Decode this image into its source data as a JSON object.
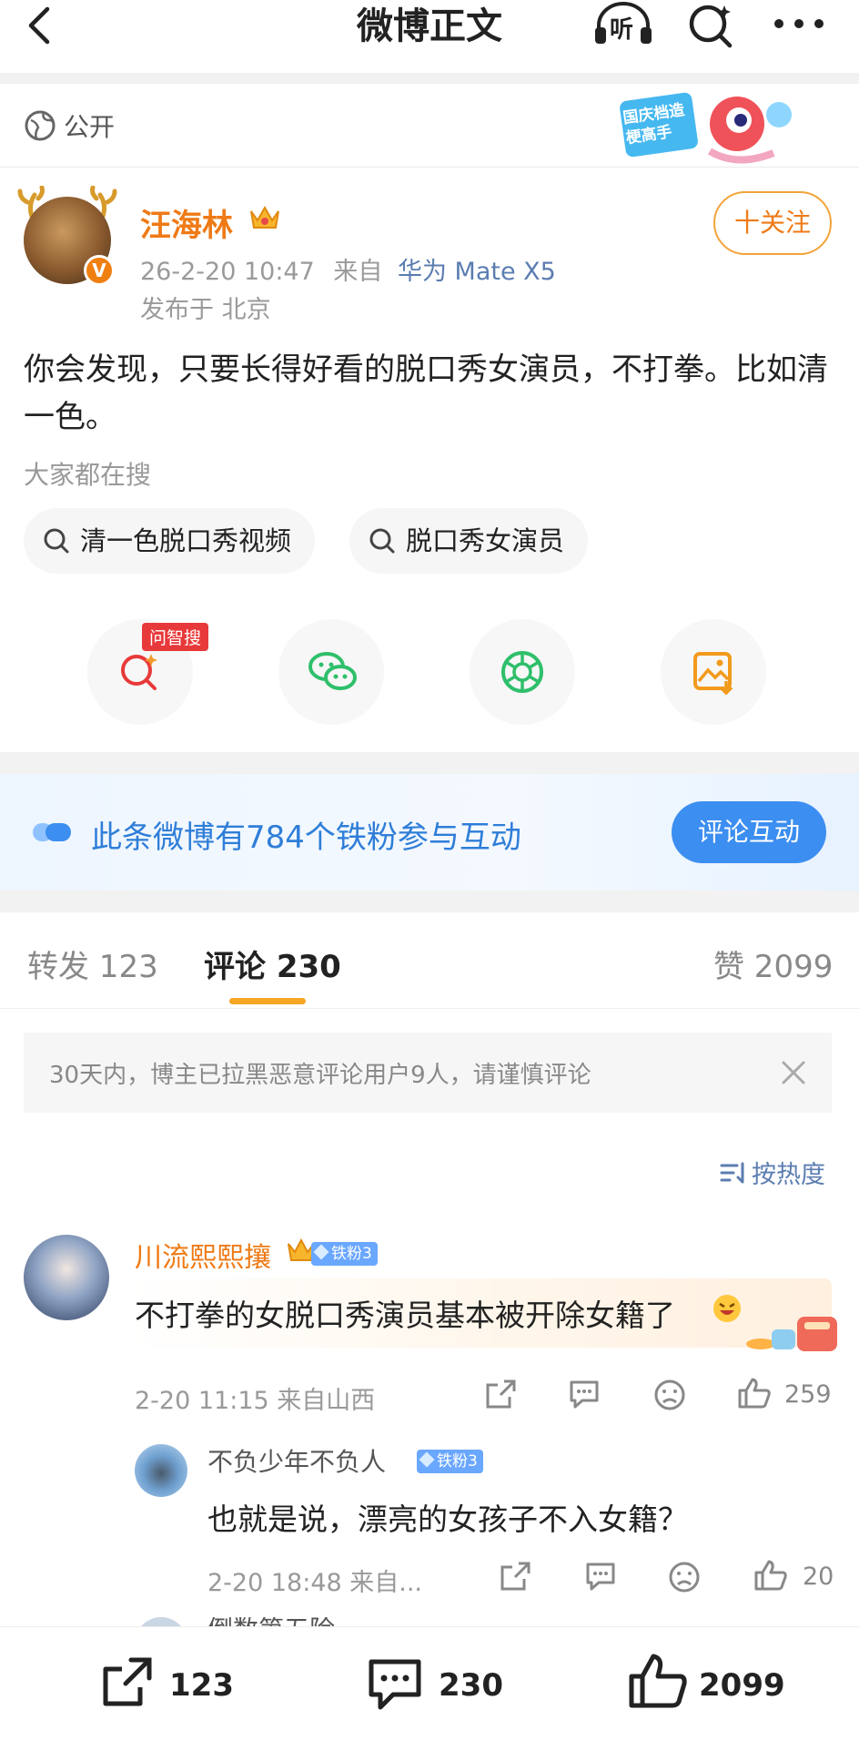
{
  "header": {
    "title": "微博正文",
    "listen_label": "听"
  },
  "post": {
    "visibility": "公开",
    "promo_text": "国庆档造梗高手",
    "author": "汪海林",
    "timestamp": "26-2-20 10:47",
    "source_prefix": "来自",
    "device": "华为 Mate X5",
    "location": "发布于 北京",
    "follow_label": "十关注",
    "text": "你会发现，只要长得好看的脱口秀女演员，不打拳。比如清一色。",
    "hot_search_label": "大家都在搜",
    "hot_searches": [
      "清一色脱口秀视频",
      "脱口秀女演员"
    ],
    "ai_search_tag": "问智搜"
  },
  "fan_banner": {
    "text": "此条微博有784个铁粉参与互动",
    "button": "评论互动"
  },
  "tabs": {
    "repost": "转发 123",
    "comments": "评论 230",
    "likes": "赞 2099"
  },
  "notice": "30天内，博主已拉黑恶意评论用户9人，请谨慎评论",
  "sort_label": "按热度",
  "comments": [
    {
      "name": "川流熙熙攘",
      "badge": "铁粉3",
      "text": "不打拳的女脱口秀演员基本被开除女籍了",
      "meta": "2-20 11:15 来自山西",
      "likes": "259"
    }
  ],
  "reply": {
    "name": "不负少年不负人",
    "badge": "铁粉3",
    "text": "也就是说，漂亮的女孩子不入女籍？",
    "meta": "2-20 18:48 来自...",
    "likes": "20"
  },
  "next_comment_partial": "倒数第五险",
  "bottom_bar": {
    "repost_count": "123",
    "comment_count": "230",
    "like_count": "2099"
  },
  "colors": {
    "accent_orange": "#ef7a16",
    "link_blue": "#5b7db1",
    "fan_blue": "#3c8ef0",
    "tab_underline": "#f5a623"
  }
}
